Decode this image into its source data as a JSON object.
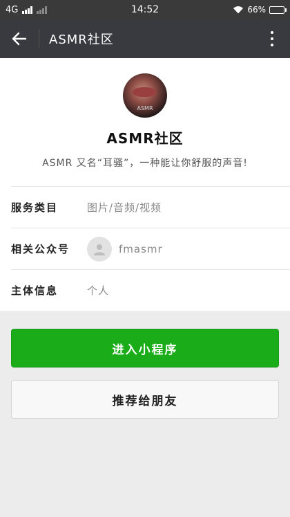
{
  "status_bar": {
    "network": "4G",
    "time": "14:52",
    "battery": "66%",
    "battery_level": 0.66
  },
  "nav": {
    "title": "ASMR社区",
    "back_icon": "arrow-left-icon",
    "more_icon": "more-vertical-icon"
  },
  "profile": {
    "avatar_text": "ASMR",
    "name": "ASMR社区",
    "description": "ASMR 又名“耳骚”，一种能让你舒服的声音!"
  },
  "info_rows": [
    {
      "label": "服务类目",
      "value": "图片/音频/视频"
    },
    {
      "label": "相关公众号",
      "value": "fmasmr"
    },
    {
      "label": "主体信息",
      "value": "个人"
    }
  ],
  "actions": {
    "enter_label": "进入小程序",
    "share_label": "推荐给朋友"
  },
  "colors": {
    "primary": "#1aad19",
    "navbar": "#393a3f"
  }
}
